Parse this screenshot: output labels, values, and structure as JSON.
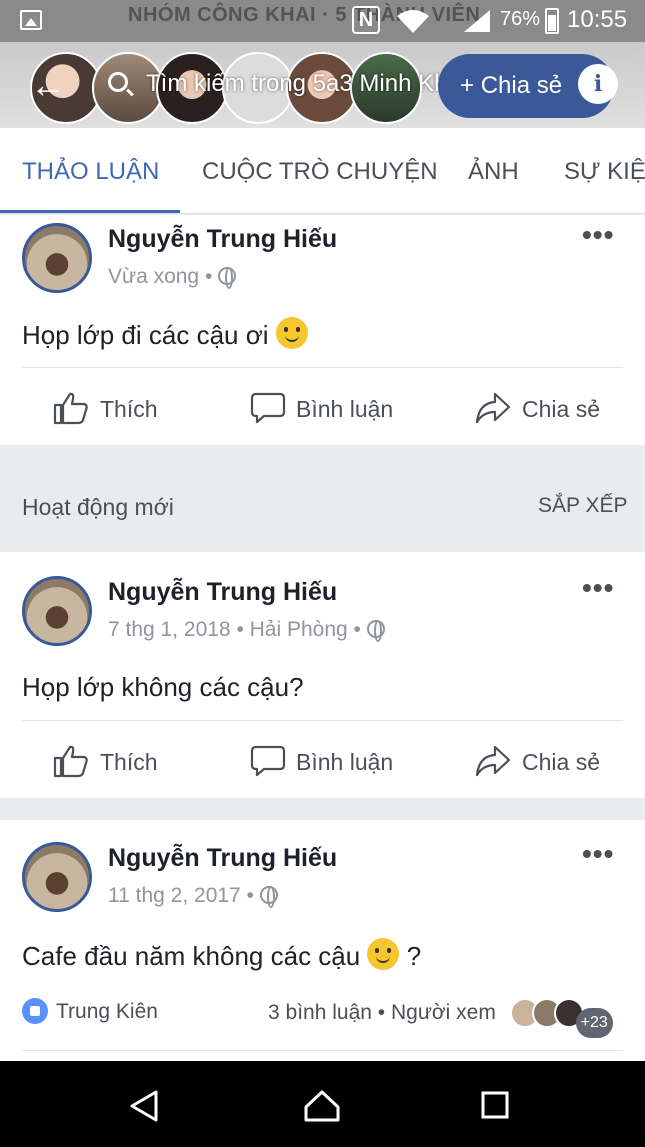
{
  "statusbar": {
    "background_text": "NHÓM CÔNG KHAI · 5 THÀNH VIÊN",
    "battery": "76%",
    "time": "10:55"
  },
  "group_header": {
    "search_placeholder": "Tìm kiếm trong 5a3 Minh Khai",
    "share_label": "Chia sẻ",
    "info_label": "i"
  },
  "tabs": [
    {
      "label": "THẢO LUẬN",
      "active": true
    },
    {
      "label": "CUỘC TRÒ CHUYỆN",
      "active": false
    },
    {
      "label": "ẢNH",
      "active": false
    },
    {
      "label": "SỰ KIỆN",
      "active": false
    }
  ],
  "posts": [
    {
      "author": "Nguyễn Trung Hiếu",
      "meta": "Vừa xong •",
      "text": "Họp lớp đi các cậu ơi",
      "actions": {
        "like": "Thích",
        "comment": "Bình luận",
        "share": "Chia sẻ"
      }
    },
    {
      "author": "Nguyễn Trung Hiếu",
      "meta": "7 thg 1, 2018 • Hải Phòng •",
      "text": "Họp lớp không các cậu?",
      "actions": {
        "like": "Thích",
        "comment": "Bình luận",
        "share": "Chia sẻ"
      }
    },
    {
      "author": "Nguyễn Trung Hiếu",
      "meta": "11 thg 2, 2017 •",
      "text": "Cafe đầu năm không các cậu",
      "text_suffix": "?",
      "reactions": {
        "liked_by": "Trung Kiên",
        "comments": "3 bình luận",
        "seen_label": "• Người xem",
        "seen_more": "+23"
      }
    }
  ],
  "section": {
    "title": "Hoạt động mới",
    "sort": "SẮP XẾP"
  },
  "colors": {
    "brand": "#4267b2",
    "header_pill": "#3b5998",
    "like_blue": "#5890ff"
  }
}
